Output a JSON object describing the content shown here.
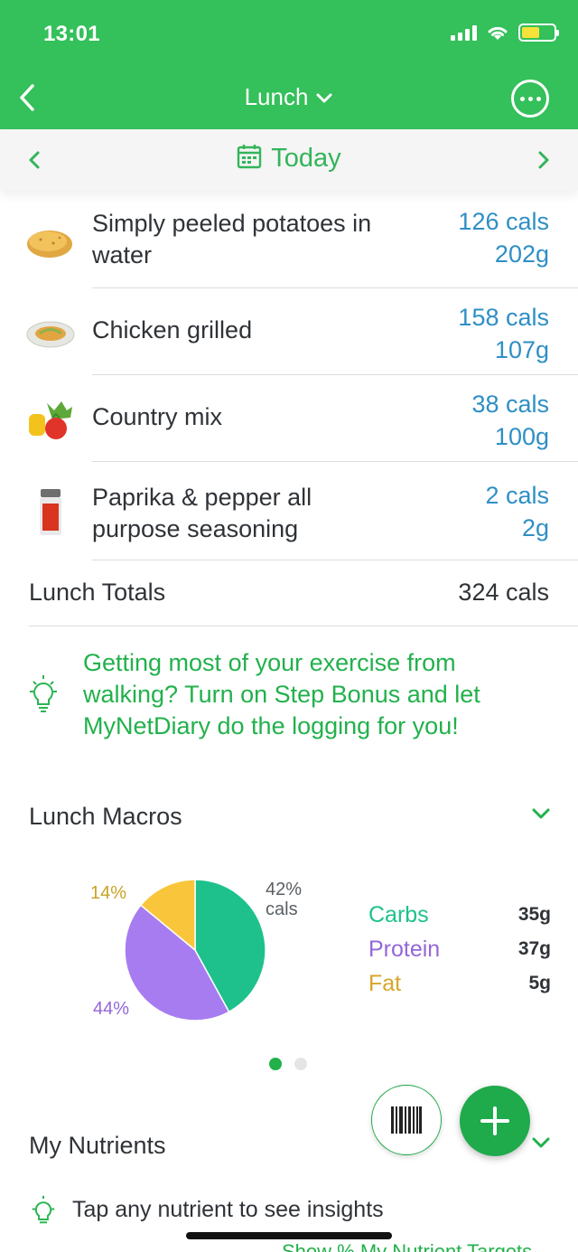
{
  "status_bar": {
    "time": "13:01"
  },
  "nav": {
    "title": "Lunch"
  },
  "date_bar": {
    "label": "Today"
  },
  "foods": [
    {
      "name": "Simply peeled potatoes in water",
      "cals": "126 cals",
      "grams": "202g",
      "icon": "potato-icon"
    },
    {
      "name": "Chicken grilled",
      "cals": "158 cals",
      "grams": "107g",
      "icon": "chicken-plate-icon"
    },
    {
      "name": "Country mix",
      "cals": "38 cals",
      "grams": "100g",
      "icon": "vegetables-icon"
    },
    {
      "name": "Paprika & pepper all purpose seasoning",
      "cals": "2 cals",
      "grams": "2g",
      "icon": "spice-jar-icon"
    }
  ],
  "totals": {
    "label": "Lunch Totals",
    "value": "324 cals"
  },
  "tip": {
    "text": "Getting most of your exercise from walking? Turn on Step Bonus and let MyNetDiary do the logging for you!"
  },
  "macros": {
    "title": "Lunch Macros",
    "pie_labels": {
      "fat": "14%",
      "carbs": "42%",
      "carbs_sub": "cals",
      "protein": "44%"
    },
    "legend": [
      {
        "label": "Carbs",
        "value": "35g",
        "color": "#1ec18c"
      },
      {
        "label": "Protein",
        "value": "37g",
        "color": "#9567d8"
      },
      {
        "label": "Fat",
        "value": "5g",
        "color": "#d6a62a"
      }
    ]
  },
  "chart_data": {
    "type": "pie",
    "categories": [
      "Carbs",
      "Protein",
      "Fat"
    ],
    "values": [
      42,
      44,
      14
    ],
    "colors": [
      "#1ec18c",
      "#a77cf0",
      "#f9c53a"
    ]
  },
  "pager": {
    "active_index": 0,
    "count": 2
  },
  "nutrients": {
    "title": "My Nutrients",
    "tip": "Tap any nutrient to see insights",
    "link": "Show % My Nutrient Targets"
  },
  "colors": {
    "brand_green": "#34c05a",
    "cal_blue": "#2f8fc5"
  }
}
